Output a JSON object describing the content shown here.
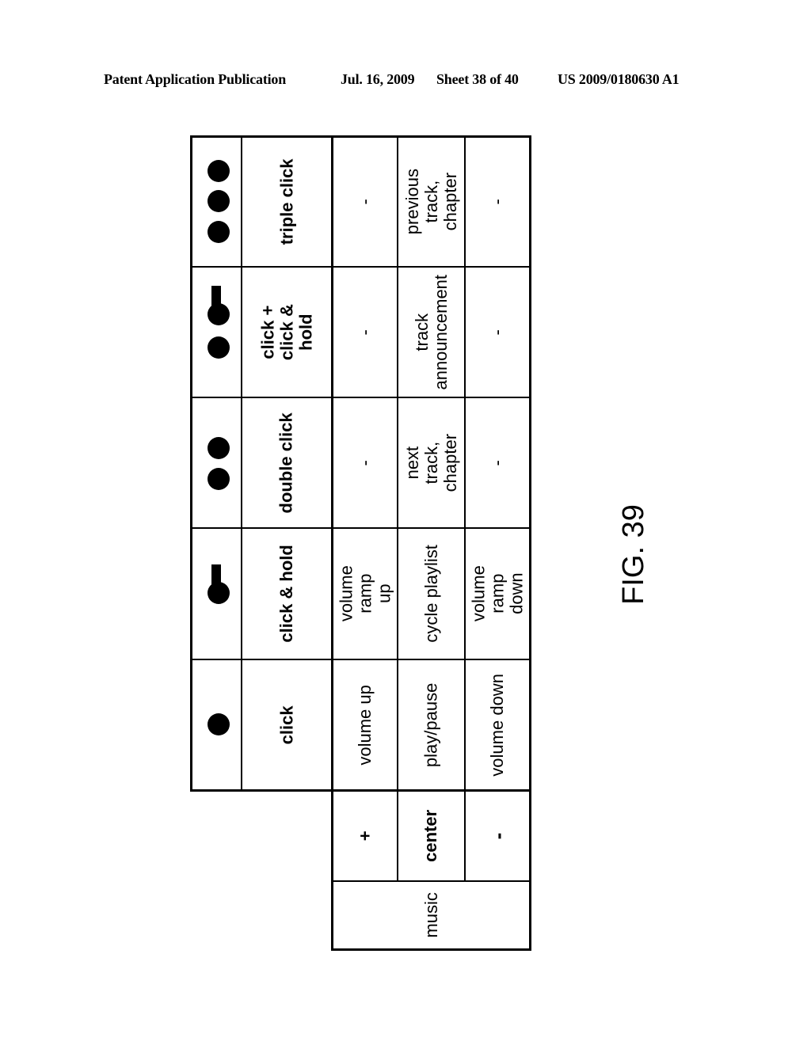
{
  "header": {
    "publication": "Patent Application Publication",
    "date": "Jul. 16, 2009",
    "sheet": "Sheet 38 of 40",
    "patent_number": "US 2009/0180630 A1"
  },
  "table": {
    "mode_label": "music",
    "buttons": [
      "+",
      "center",
      "-"
    ],
    "gestures": [
      {
        "name": "click",
        "icon": "single-dot-icon",
        "actions": {
          "plus": "volume up",
          "center": "play/pause",
          "minus": "volume down"
        }
      },
      {
        "name": "click & hold",
        "icon": "dot-with-hold-bar-icon",
        "actions": {
          "plus": "volume ramp up",
          "center": "cycle playlist",
          "minus": "volume ramp down"
        }
      },
      {
        "name": "double click",
        "icon": "two-dots-icon",
        "actions": {
          "plus": "-",
          "center": "next track, chapter",
          "minus": "-"
        }
      },
      {
        "name": "click + click & hold",
        "icon": "dot-plus-hold-icon",
        "actions": {
          "plus": "-",
          "center": "track announcement",
          "minus": "-"
        }
      },
      {
        "name": "triple click",
        "icon": "three-dots-icon",
        "actions": {
          "plus": "-",
          "center": "previous track, chapter",
          "minus": "-"
        }
      }
    ]
  },
  "figure_label": "FIG. 39"
}
